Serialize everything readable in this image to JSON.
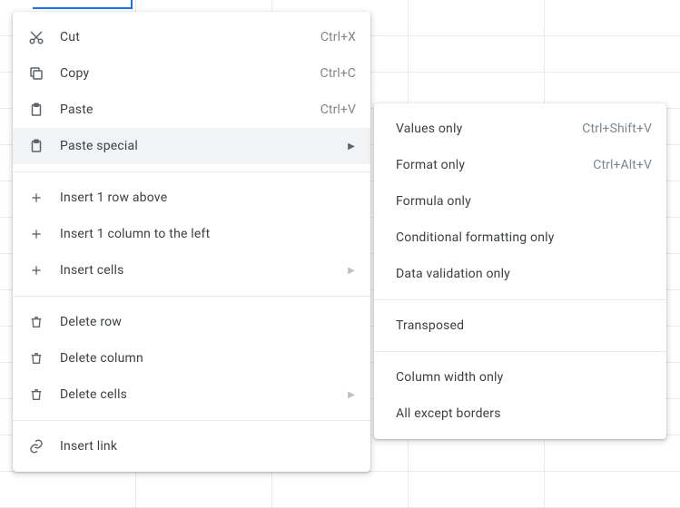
{
  "menu": {
    "cut": {
      "label": "Cut",
      "shortcut": "Ctrl+X"
    },
    "copy": {
      "label": "Copy",
      "shortcut": "Ctrl+C"
    },
    "paste": {
      "label": "Paste",
      "shortcut": "Ctrl+V"
    },
    "paste_special": {
      "label": "Paste special"
    },
    "insert_row_above": {
      "label": "Insert 1 row above"
    },
    "insert_col_left": {
      "label": "Insert 1 column to the left"
    },
    "insert_cells": {
      "label": "Insert cells"
    },
    "delete_row": {
      "label": "Delete row"
    },
    "delete_column": {
      "label": "Delete column"
    },
    "delete_cells": {
      "label": "Delete cells"
    },
    "insert_link": {
      "label": "Insert link"
    }
  },
  "submenu": {
    "values_only": {
      "label": "Values only",
      "shortcut": "Ctrl+Shift+V"
    },
    "format_only": {
      "label": "Format only",
      "shortcut": "Ctrl+Alt+V"
    },
    "formula_only": {
      "label": "Formula only"
    },
    "cond_fmt_only": {
      "label": "Conditional formatting only"
    },
    "data_val_only": {
      "label": "Data validation only"
    },
    "transposed": {
      "label": "Transposed"
    },
    "col_width_only": {
      "label": "Column width only"
    },
    "all_except_borders": {
      "label": "All except borders"
    }
  }
}
